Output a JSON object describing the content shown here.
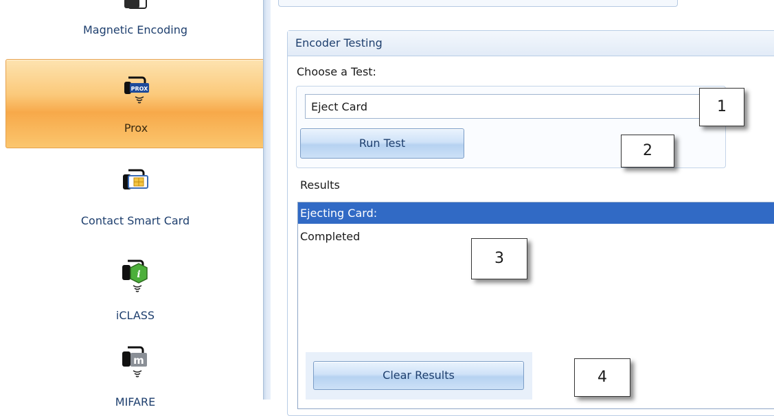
{
  "sidebar": {
    "items": [
      {
        "label": "Magnetic Encoding",
        "icon": "magnetic-card-icon",
        "selected": false
      },
      {
        "label": "Prox",
        "icon": "prox-card-icon",
        "selected": true
      },
      {
        "label": "Contact Smart Card",
        "icon": "smart-card-chip-icon",
        "selected": false
      },
      {
        "label": "iCLASS",
        "icon": "iclass-card-icon",
        "selected": false
      },
      {
        "label": "MIFARE",
        "icon": "mifare-card-icon",
        "selected": false
      }
    ]
  },
  "encoder_testing": {
    "title": "Encoder Testing",
    "choose_label": "Choose a Test:",
    "selected_test": "Eject Card",
    "run_button": "Run Test",
    "results_label": "Results",
    "results": [
      {
        "text": "Ejecting Card:",
        "selected": true
      },
      {
        "text": "Completed",
        "selected": false
      }
    ],
    "clear_button": "Clear Results"
  },
  "callouts": [
    "1",
    "2",
    "3",
    "4"
  ],
  "colors": {
    "selected_nav": "#f7a94a",
    "selection_highlight": "#316ac5",
    "nav_text": "#1e3f6e"
  }
}
